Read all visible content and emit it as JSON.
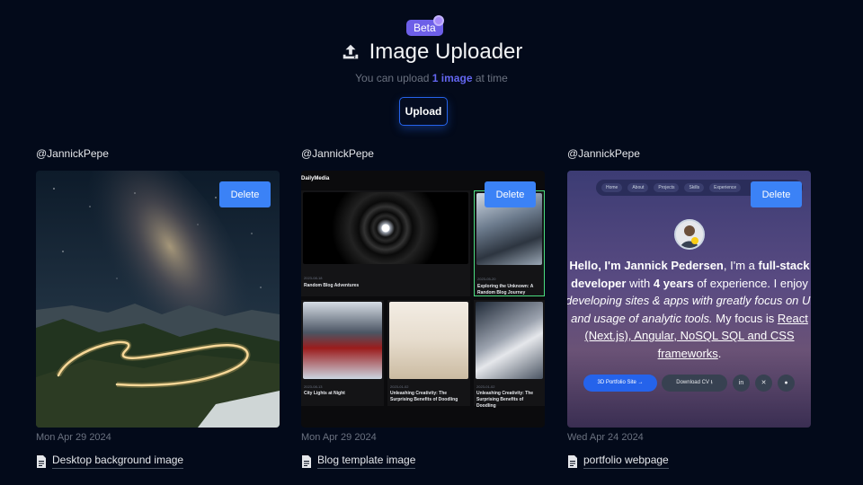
{
  "header": {
    "badge": "Beta",
    "title": "Image Uploader",
    "subtitle_pre": "You can upload",
    "subtitle_highlight": "1 image",
    "subtitle_post": "at time",
    "upload_label": "Upload",
    "icon": "upload-icon"
  },
  "colors": {
    "background": "#030a1a",
    "accent": "#3b82f6",
    "badge": "#6d5fe8",
    "highlight": "#6366f1"
  },
  "cards": [
    {
      "user": "@JannickPepe",
      "delete_label": "Delete",
      "date": "Mon Apr 29 2024",
      "file_name": "Desktop background image",
      "file_icon": "document-icon"
    },
    {
      "user": "@JannickPepe",
      "delete_label": "Delete",
      "date": "Mon Apr 29 2024",
      "file_name": "Blog template image",
      "file_icon": "document-icon",
      "preview": {
        "logo": "DailyMedia",
        "posts": [
          {
            "date": "2023-08-18",
            "title": "Random Blog Adventures"
          },
          {
            "date": "2023-05-20",
            "title": "Exploring the Unknown: A Random Blog Journey"
          },
          {
            "date": "2023-08-13",
            "title": "City Lights at Night"
          },
          {
            "date": "2023-01-02",
            "title": "Unleashing Creativity: The Surprising Benefits of Doodling"
          },
          {
            "date": "2023-01-02",
            "title": "Unleashing Creativity: The Surprising Benefits of Doodling"
          }
        ]
      }
    },
    {
      "user": "@JannickPepe",
      "delete_label": "Delete",
      "date": "Wed Apr 24 2024",
      "file_name": "portfolio webpage",
      "file_icon": "document-icon",
      "preview": {
        "nav": [
          "Home",
          "About",
          "Projects",
          "Skills",
          "Experience"
        ],
        "line1_pre": "Hello, I'm",
        "name": "Jannick Pedersen",
        "line1_mid": ", I'm a",
        "role": "full-stack developer",
        "line2_mid": "with",
        "years": "4 years",
        "line2_post": "of experience.",
        "line3_pre": "I enjoy",
        "line3_italic": "developing sites & apps with greatly focus on UI and usage of analytic tools.",
        "line4_pre": "My focus is",
        "line4_link": "React (Next.js), Angular, NoSQL SQL and CSS frameworks",
        "line4_post": ".",
        "btn_primary": "3D Portfolio Site →",
        "btn_secondary": "Download CV ⭳",
        "social_icons": [
          "linkedin-icon",
          "x-icon",
          "github-icon"
        ]
      }
    }
  ]
}
